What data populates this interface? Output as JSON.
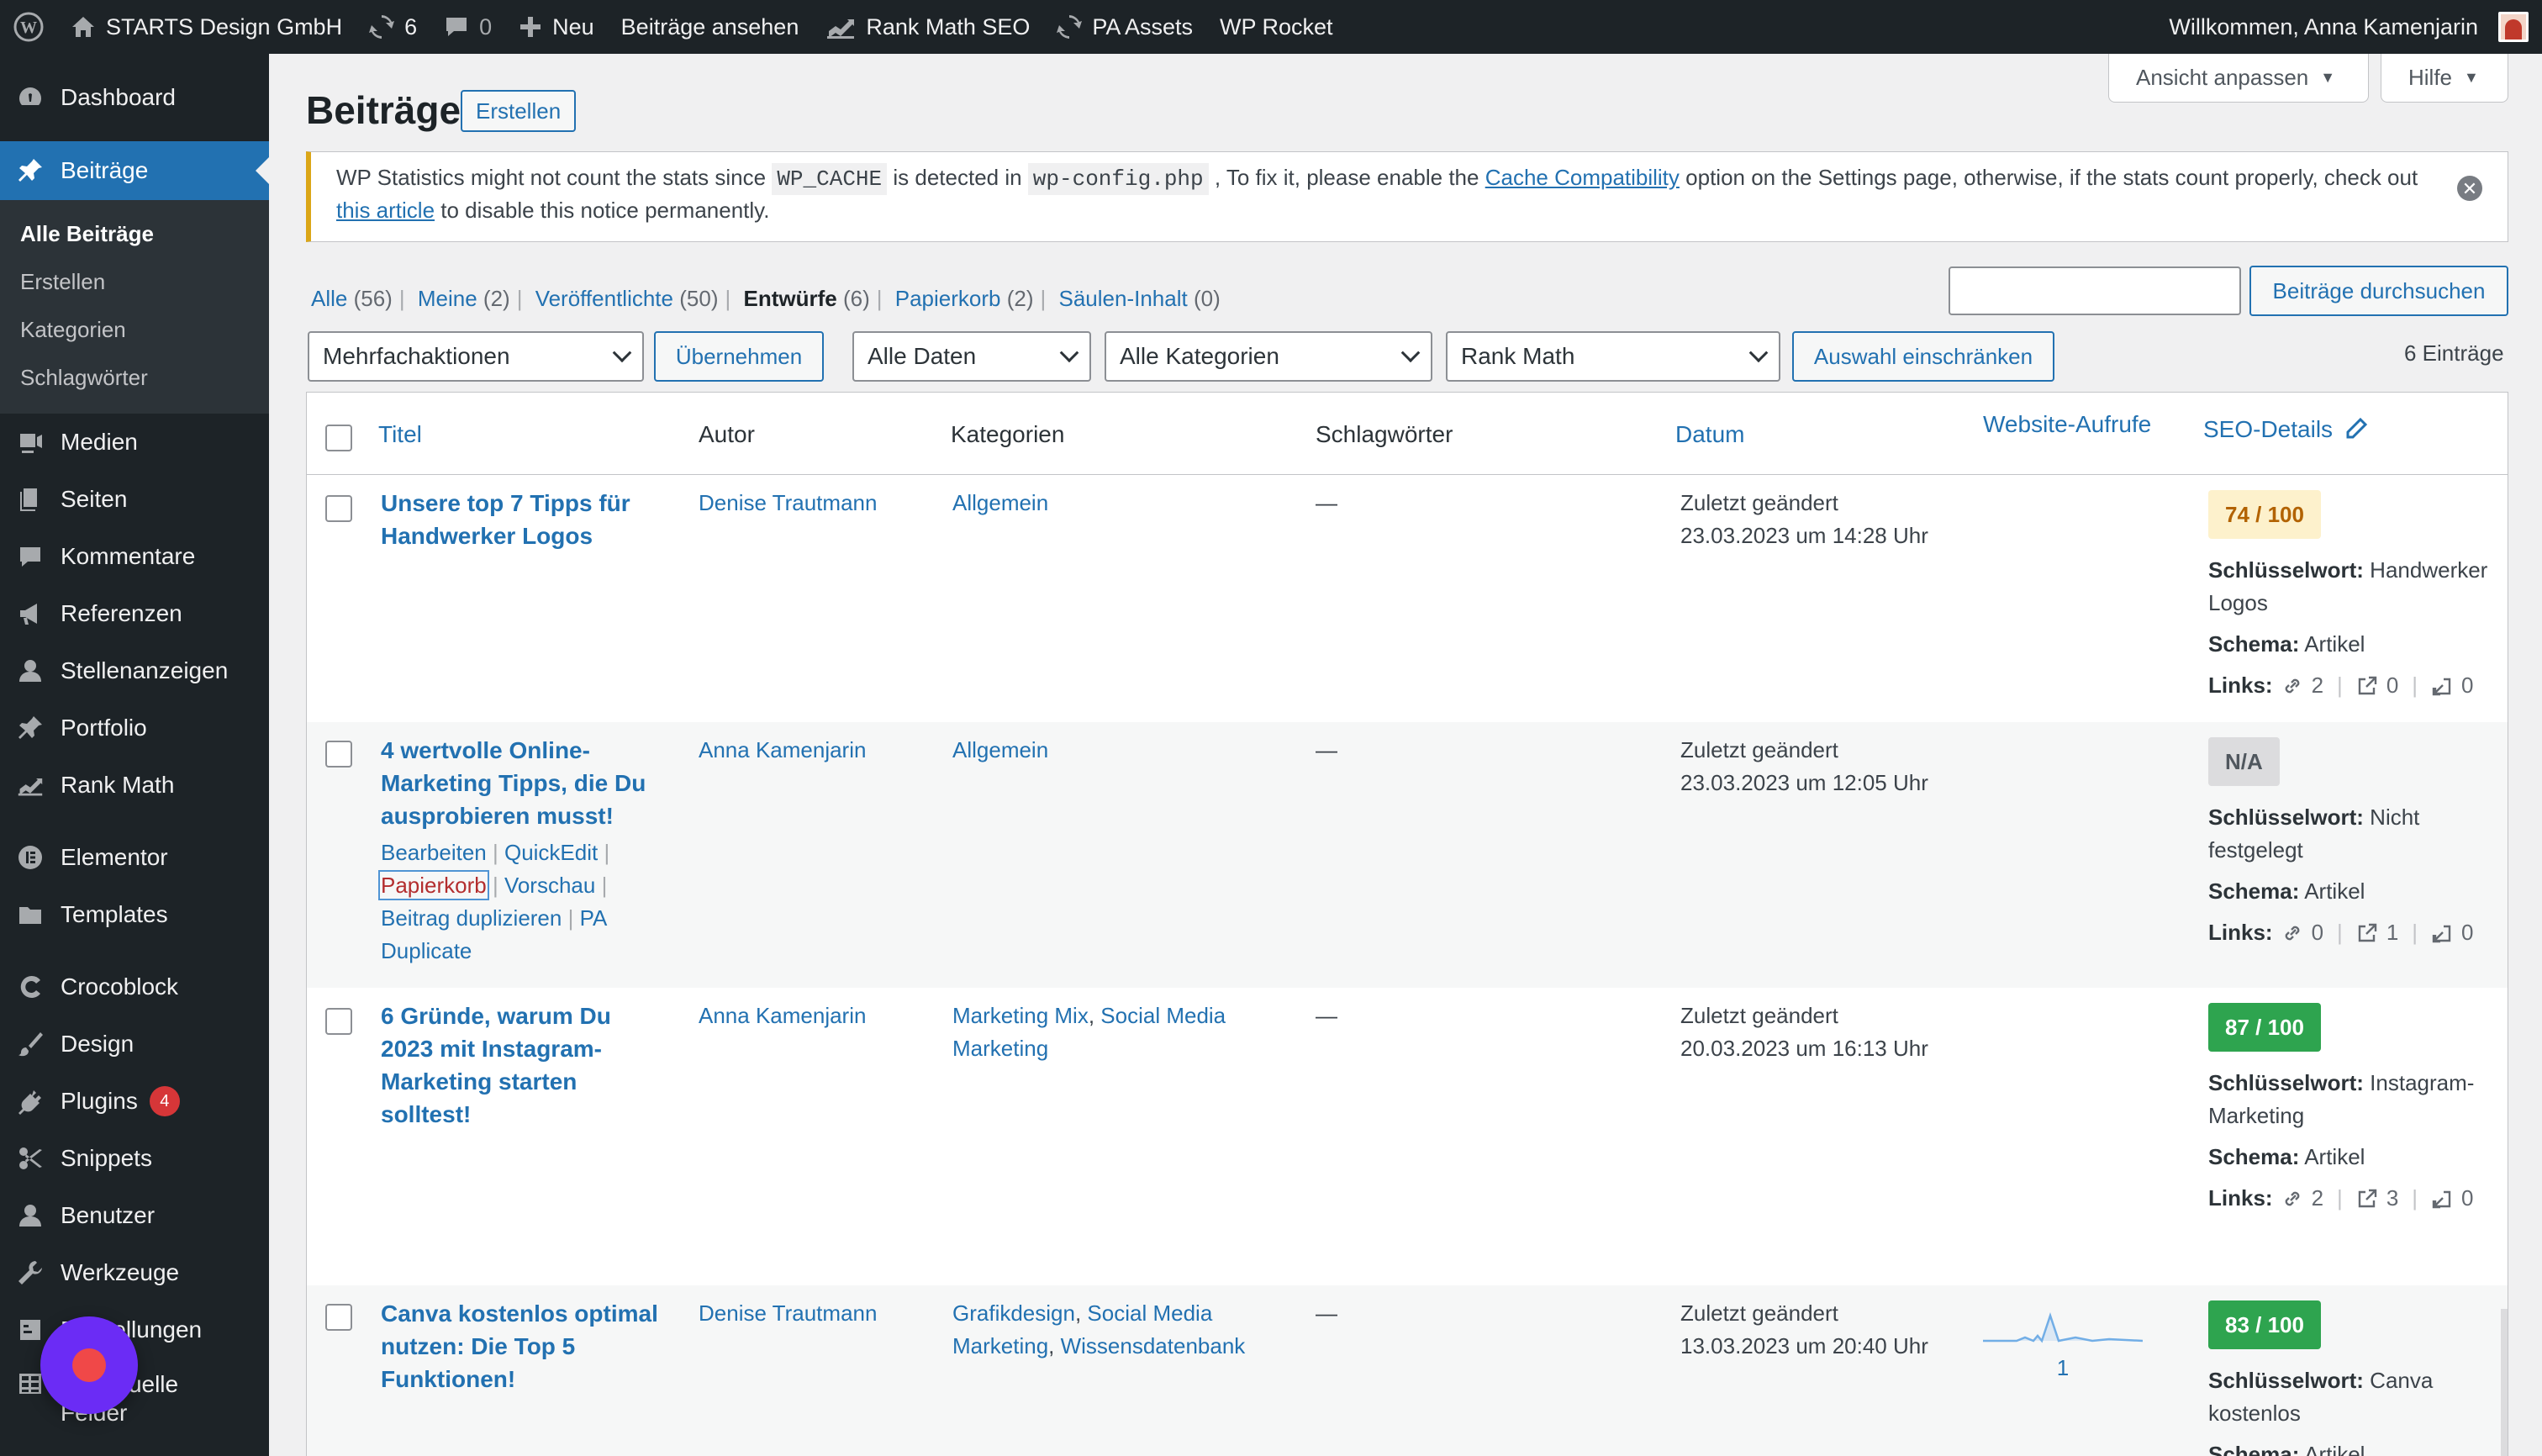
{
  "adminbar": {
    "site_name": "STARTS Design GmbH",
    "updates_count": "6",
    "comments_count": "0",
    "new_label": "Neu",
    "view_posts": "Beiträge ansehen",
    "rank_math": "Rank Math SEO",
    "pa_assets": "PA Assets",
    "wp_rocket": "WP Rocket",
    "greeting": "Willkommen, Anna Kamenjarin"
  },
  "sidebar": {
    "dashboard": "Dashboard",
    "posts": "Beiträge",
    "sub": [
      "Alle Beiträge",
      "Erstellen",
      "Kategorien",
      "Schlagwörter"
    ],
    "media": "Medien",
    "pages": "Seiten",
    "comments": "Kommentare",
    "references": "Referenzen",
    "jobs": "Stellenanzeigen",
    "portfolio": "Portfolio",
    "rankmath": "Rank Math",
    "elementor": "Elementor",
    "templates": "Templates",
    "crocoblock": "Crocoblock",
    "design": "Design",
    "plugins": "Plugins",
    "plugins_badge": "4",
    "snippets": "Snippets",
    "users": "Benutzer",
    "tools": "Werkzeuge",
    "settings": "Einstellungen",
    "custom_fields_1": "Individuelle",
    "custom_fields_2": "Felder"
  },
  "screen_options": "Ansicht anpassen",
  "help": "Hilfe",
  "page_title": "Beiträge",
  "create_button": "Erstellen",
  "notice": {
    "t1": "WP Statistics might not count the stats since ",
    "code1": "WP_CACHE",
    "t2": " is detected in ",
    "code2": "wp-config.php",
    "t3": " , To fix it, please enable the ",
    "link1": "Cache Compatibility",
    "t4": " option on the Settings page, otherwise, if the stats count properly, check out ",
    "link2": "this article",
    "t5": " to disable this notice permanently."
  },
  "views": [
    {
      "label": "Alle",
      "count": "(56)"
    },
    {
      "label": "Meine",
      "count": "(2)"
    },
    {
      "label": "Veröffentlichte",
      "count": "(50)"
    },
    {
      "label": "Entwürfe",
      "count": "(6)"
    },
    {
      "label": "Papierkorb",
      "count": "(2)"
    },
    {
      "label": "Säulen-Inhalt",
      "count": "(0)"
    }
  ],
  "search_button": "Beiträge durchsuchen",
  "filters": {
    "bulk": "Mehrfachaktionen",
    "apply": "Übernehmen",
    "dates": "Alle Daten",
    "categories": "Alle Kategorien",
    "rankmath": "Rank Math",
    "filter_btn": "Auswahl einschränken",
    "count": "6 Einträge"
  },
  "columns": {
    "title": "Titel",
    "author": "Autor",
    "categories": "Kategorien",
    "tags": "Schlagwörter",
    "date": "Datum",
    "visits": "Website-Aufrufe",
    "seo": "SEO-Details"
  },
  "rows": [
    {
      "title": "Unsere top 7 Tipps für Handwerker Logos",
      "author": "Denise Trautmann",
      "cat1": "Allgemein",
      "tags": "—",
      "date_label": "Zuletzt geändert",
      "date": "23.03.2023 um 14:28 Uhr",
      "score": "74 / 100",
      "kw_label": "Schlüsselwort:",
      "kw": "Handwerker Logos",
      "schema_label": "Schema:",
      "schema": "Artikel",
      "links_label": "Links:",
      "l_int": "2",
      "l_ext": "0",
      "l_in": "0"
    },
    {
      "title": "4 wertvolle Online-Marketing Tipps, die Du ausprobieren musst!",
      "author": "Anna Kamenjarin",
      "cat1": "Allgemein",
      "tags": "—",
      "date_label": "Zuletzt geändert",
      "date": "23.03.2023 um 12:05 Uhr",
      "actions": {
        "edit": "Bearbeiten",
        "quickedit": "QuickEdit",
        "trash": "Papierkorb",
        "preview": "Vorschau",
        "duplicate": "Beitrag duplizieren",
        "pa_duplicate": "PA Duplicate"
      },
      "score": "N/A",
      "kw_label": "Schlüsselwort:",
      "kw": "Nicht festgelegt",
      "schema_label": "Schema:",
      "schema": "Artikel",
      "links_label": "Links:",
      "l_int": "0",
      "l_ext": "1",
      "l_in": "0"
    },
    {
      "title": "6 Gründe, warum Du 2023 mit Instagram-Marketing starten solltest!",
      "author": "Anna Kamenjarin",
      "cat1": "Marketing Mix",
      "cat2": "Social Media Marketing",
      "tags": "—",
      "date_label": "Zuletzt geändert",
      "date": "20.03.2023 um 16:13 Uhr",
      "score": "87 / 100",
      "kw_label": "Schlüsselwort:",
      "kw": "Instagram-Marketing",
      "schema_label": "Schema:",
      "schema": "Artikel",
      "links_label": "Links:",
      "l_int": "2",
      "l_ext": "3",
      "l_in": "0"
    },
    {
      "title": "Canva kostenlos optimal nutzen: Die Top 5 Funktionen!",
      "author": "Denise Trautmann",
      "cat1": "Grafikdesign",
      "cat2": "Social Media Marketing",
      "cat3": "Wissensdatenbank",
      "tags": "—",
      "date_label": "Zuletzt geändert",
      "date": "13.03.2023 um 20:40 Uhr",
      "visits": "1",
      "score": "83 / 100",
      "kw_label": "Schlüsselwort:",
      "kw": "Canva kostenlos",
      "schema_label": "Schema:",
      "schema": "Artikel"
    }
  ],
  "colors": {
    "admin_bg": "#1d2327",
    "accent": "#2271b1",
    "score_orange_bg": "#fdf1cc",
    "score_orange_text": "#b26200",
    "score_green_bg": "#2ea44f",
    "score_na_bg": "#dcdcde",
    "notice_border": "#dba617"
  }
}
